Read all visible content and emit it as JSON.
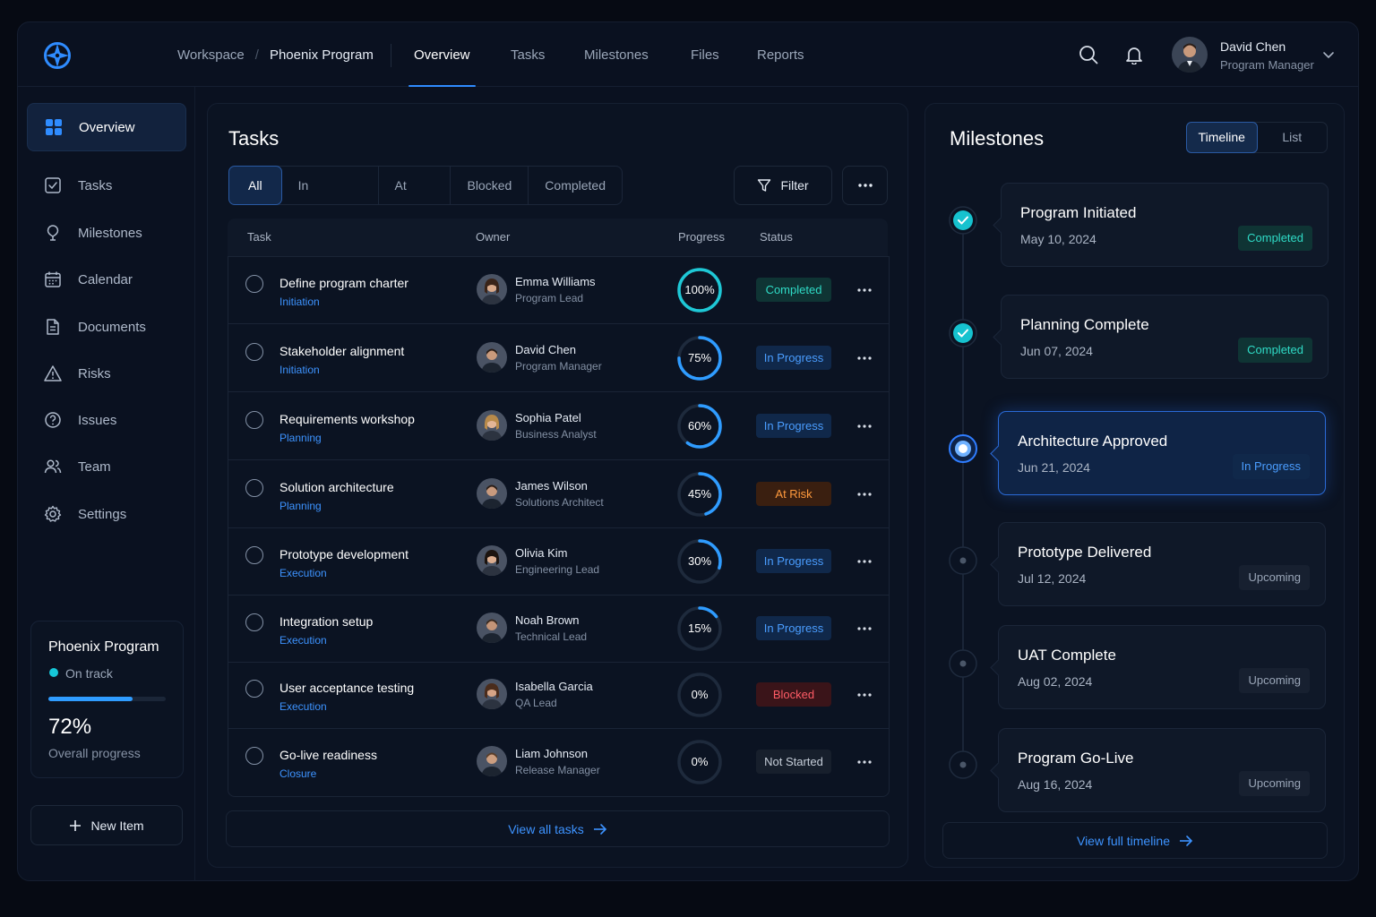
{
  "header": {
    "breadcrumb": [
      "Workspace",
      "Phoenix Program"
    ],
    "tabs": [
      "Overview",
      "Tasks",
      "Milestones",
      "Files",
      "Reports"
    ],
    "active_tab": "Overview",
    "user": {
      "name": "David Chen",
      "role": "Program Manager"
    },
    "icons": [
      "search-icon",
      "bell-icon",
      "chevron-down-icon"
    ]
  },
  "sidebar": {
    "items": [
      {
        "label": "Overview",
        "icon": "grid-icon"
      },
      {
        "label": "Tasks",
        "icon": "checkbox-icon"
      },
      {
        "label": "Milestones",
        "icon": "milestone-icon"
      },
      {
        "label": "Calendar",
        "icon": "calendar-icon"
      },
      {
        "label": "Documents",
        "icon": "document-icon"
      },
      {
        "label": "Risks",
        "icon": "warning-icon"
      },
      {
        "label": "Issues",
        "icon": "question-icon"
      },
      {
        "label": "Team",
        "icon": "team-icon"
      },
      {
        "label": "Settings",
        "icon": "gear-icon"
      }
    ],
    "program_card": {
      "title": "Phoenix Program",
      "status": "On track",
      "progress": 0.72,
      "percent": "72%",
      "label": "Overall progress"
    },
    "new_item": "New Item"
  },
  "tasks": {
    "title": "Tasks",
    "filters": [
      "All",
      "In Progress",
      "At Risk",
      "Blocked",
      "Completed"
    ],
    "filter_button": "Filter",
    "columns": [
      "Task",
      "Owner",
      "Progress",
      "Status"
    ],
    "rows": [
      {
        "name": "Define program charter",
        "phase": "Initiation",
        "owner": "Emma Williams",
        "role": "Program Lead",
        "progress": 100,
        "progress_label": "100%",
        "status": "Completed",
        "status_type": "completed"
      },
      {
        "name": "Stakeholder alignment",
        "phase": "Initiation",
        "owner": "David Chen",
        "role": "Program Manager",
        "progress": 75,
        "progress_label": "75%",
        "status": "In Progress",
        "status_type": "progress"
      },
      {
        "name": "Requirements workshop",
        "phase": "Planning",
        "owner": "Sophia Patel",
        "role": "Business Analyst",
        "progress": 60,
        "progress_label": "60%",
        "status": "In Progress",
        "status_type": "progress"
      },
      {
        "name": "Solution architecture",
        "phase": "Planning",
        "owner": "James Wilson",
        "role": "Solutions Architect",
        "progress": 45,
        "progress_label": "45%",
        "status": "At Risk",
        "status_type": "risk"
      },
      {
        "name": "Prototype development",
        "phase": "Execution",
        "owner": "Olivia Kim",
        "role": "Engineering Lead",
        "progress": 30,
        "progress_label": "30%",
        "status": "In Progress",
        "status_type": "progress"
      },
      {
        "name": "Integration setup",
        "phase": "Execution",
        "owner": "Noah Brown",
        "role": "Technical Lead",
        "progress": 15,
        "progress_label": "15%",
        "status": "In Progress",
        "status_type": "progress"
      },
      {
        "name": "User acceptance testing",
        "phase": "Execution",
        "owner": "Isabella Garcia",
        "role": "QA Lead",
        "progress": 0,
        "progress_label": "0%",
        "status": "Blocked",
        "status_type": "blocked"
      },
      {
        "name": "Go-live readiness",
        "phase": "Closure",
        "owner": "Liam Johnson",
        "role": "Release Manager",
        "progress": 0,
        "progress_label": "0%",
        "status": "Not Started",
        "status_type": "notstarted"
      }
    ],
    "view_all": "View all tasks"
  },
  "milestones": {
    "title": "Milestones",
    "views": [
      "Timeline",
      "List"
    ],
    "active_view": "Timeline",
    "items": [
      {
        "name": "Program Initiated",
        "date": "May 10, 2024",
        "status": "Completed",
        "status_type": "completed"
      },
      {
        "name": "Planning Complete",
        "date": "Jun 07, 2024",
        "status": "Completed",
        "status_type": "completed"
      },
      {
        "name": "Architecture Approved",
        "date": "Jun 21, 2024",
        "status": "In Progress",
        "status_type": "progress"
      },
      {
        "name": "Prototype Delivered",
        "date": "Jul 12, 2024",
        "status": "Upcoming",
        "status_type": "upcoming"
      },
      {
        "name": "UAT Complete",
        "date": "Aug 02, 2024",
        "status": "Upcoming",
        "status_type": "upcoming"
      },
      {
        "name": "Program Go-Live",
        "date": "Aug 16, 2024",
        "status": "Upcoming",
        "status_type": "upcoming"
      }
    ],
    "view_full": "View full timeline"
  },
  "colors": {
    "accent": "#2f8cff",
    "teal": "#16c7d8",
    "background": "#0a1120"
  }
}
